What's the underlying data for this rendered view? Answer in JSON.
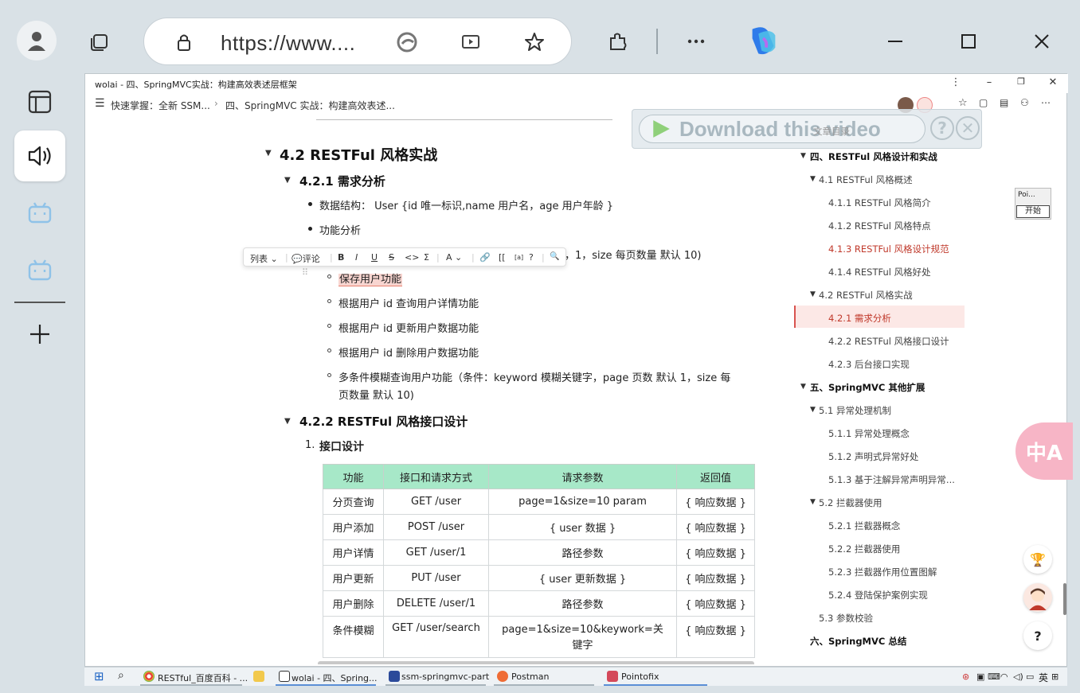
{
  "browser": {
    "url": "https://www...."
  },
  "inner": {
    "title": "wolai - 四、SpringMVC实战：构建高效表述层框架",
    "breadcrumb": [
      "快速掌握：全新 SSM...",
      "四、SpringMVC 实战：构建高效表述..."
    ]
  },
  "download_banner": {
    "label": "Download this video",
    "help": "?",
    "close": "✕"
  },
  "content": {
    "h2": "4.2 RESTFul 风格实战",
    "h3_1": "4.2.1 需求分析",
    "data_structure": "数据结构： User {id 唯一标识,name 用户名，age 用户年龄 }",
    "func_analysis": "功能分析",
    "paging_tail": "，1，size 每页数量 默认 10)",
    "items": [
      "保存用户功能",
      "根据用户 id 查询用户详情功能",
      "根据用户 id 更新用户数据功能",
      "根据用户 id 删除用户数据功能"
    ],
    "multi_line1": "多条件模糊查询用户功能（条件：keyword 模糊关键字，page 页数 默认 1，size 每",
    "multi_line2": "页数量 默认 10)",
    "h3_2": "4.2.2 RESTFul 风格接口设计",
    "ol1": "1.",
    "ol1_text": "接口设计"
  },
  "toolbar": {
    "list": "列表",
    "comment": "评论",
    "bold": "B",
    "italic": "I",
    "underline": "U",
    "strike": "S",
    "code": "<>",
    "sigma": "Σ",
    "font": "A",
    "link": "🔗",
    "bracket": "[[",
    "sup": "[a]",
    "help": "?",
    "search": "🔍"
  },
  "table": {
    "headers": [
      "功能",
      "接口和请求方式",
      "请求参数",
      "返回值"
    ],
    "rows": [
      [
        "分页查询",
        "GET  /user",
        "page=1&size=10 param",
        "{ 响应数据 }"
      ],
      [
        "用户添加",
        "POST /user",
        "{ user 数据 }",
        "{ 响应数据 }"
      ],
      [
        "用户详情",
        "GET /user/1",
        "路径参数",
        "{ 响应数据 }"
      ],
      [
        "用户更新",
        "PUT /user",
        "{ user 更新数据 }",
        "{ 响应数据 }"
      ],
      [
        "用户删除",
        "DELETE /user/1",
        "路径参数",
        "{ 响应数据 }"
      ],
      [
        "条件模糊",
        "GET /user/search",
        "page=1&size=10&keywork=关键字",
        "{ 响应数据 }"
      ]
    ]
  },
  "outline": {
    "header": "文章目录",
    "items": [
      "四、RESTFul 风格设计和实战",
      "4.1 RESTFul 风格概述",
      "4.1.1 RESTFul 风格简介",
      "4.1.2 RESTFul 风格特点",
      "4.1.3 RESTFul 风格设计规范",
      "4.1.4 RESTFul 风格好处",
      "4.2 RESTFul 风格实战",
      "4.2.1 需求分析",
      "4.2.2 RESTFul 风格接口设计",
      "4.2.3 后台接口实现",
      "五、SpringMVC 其他扩展",
      "5.1 异常处理机制",
      "5.1.1 异常处理概念",
      "5.1.2 声明式异常好处",
      "5.1.3 基于注解异常声明异常...",
      "5.2 拦截器使用",
      "5.2.1 拦截器概念",
      "5.2.2 拦截器使用",
      "5.2.3 拦截器作用位置图解",
      "5.2.4 登陆保护案例实现",
      "5.3 参数校验",
      "六、SpringMVC 总结"
    ]
  },
  "poi": {
    "label": "Poi...",
    "start": "开始"
  },
  "translate": "中A",
  "help_round": "?",
  "taskbar": {
    "items": [
      "RESTful_百度百科 - ...",
      "wolai - 四、Spring...",
      "ssm-springmvc-part",
      "Postman",
      "Pointofix"
    ],
    "lang": "英"
  },
  "colors": {
    "accent_red": "#c0392b",
    "table_header": "#a7e8c8",
    "highlight": "#f8d5d0"
  }
}
